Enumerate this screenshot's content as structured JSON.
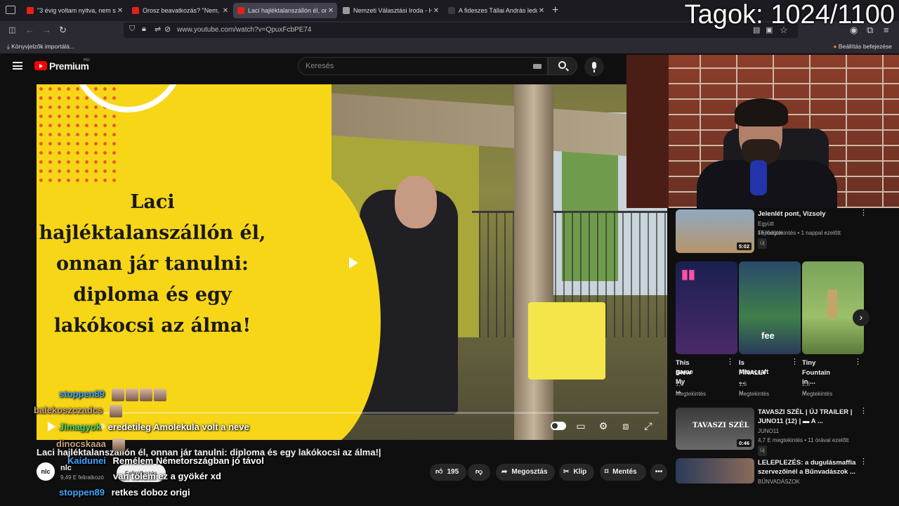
{
  "browser": {
    "tabs": [
      {
        "title": "\"3 évig voltam nyitva, nem szeretn",
        "active": false,
        "fav": "#e62117"
      },
      {
        "title": "Orosz beavatkozás? \"Nem, nem",
        "active": false,
        "fav": "#e62117"
      },
      {
        "title": "Laci hajléktalanszállón él, onnan",
        "active": true,
        "fav": "#e62117"
      },
      {
        "title": "Nemzeti Választási Iroda - Helyi",
        "active": false,
        "fav": "#9a9a9a"
      },
      {
        "title": "A fideszes Tállai András ledobta",
        "active": false,
        "fav": "#3b3b3b"
      }
    ],
    "url": "www.youtube.com/watch?v=QpuxFcbPE74",
    "bookmarks_import": "Könyvjelzők importálá...",
    "finish_setup": "Beállítás befejezése"
  },
  "overlay": {
    "members": "Tagok: 1024/1100"
  },
  "youtube": {
    "brand": "Premium",
    "region": "HU",
    "search_placeholder": "Keresés"
  },
  "video": {
    "thumbnail_text": [
      "Laci",
      "hajléktalanszállón él,",
      "onnan jár tanulni:",
      "diploma és egy",
      "lakókocsi az álma!"
    ],
    "title": "Laci hajléktalanszállón él, onnan jár tanulni: diploma és egy lakókocsi az álma!|",
    "channel": "nlc",
    "channel_avatar": "nlc",
    "subscribers": "9,49 E feliratkozó",
    "subscribe_label": "Feliratkozás",
    "likes": "195",
    "share_label": "Megosztás",
    "clip_label": "Klip",
    "save_label": "Mentés"
  },
  "sidebar": {
    "top_rec": {
      "title": "Jelenlét pont, Vizsoly",
      "channel": "Együtt Fejlődünk",
      "meta": "15 megtekintés • 1 nappal ezelőtt",
      "badge": "Új",
      "duration": "5:02"
    },
    "shorts": [
      {
        "title1": "This game",
        "title2": "Blew My ...",
        "views": "1,6 M",
        "views_label": "megtekintés",
        "color": "#2a3a6a"
      },
      {
        "title1": "Is Minecraft",
        "title2": "FINALLY ...",
        "views": "1,6 M",
        "views_label": "megtekintés",
        "color": "#3a6a8a",
        "overlay": "fee"
      },
      {
        "title1": "Tiny",
        "title2": "Fountain in ...",
        "views": "2,8 M",
        "views_label": "megtekintés",
        "color": "#5a8a4a"
      }
    ],
    "recs": [
      {
        "title1": "TAVASZI SZÉL | ÚJ TRAILER |",
        "title2": "JUNO11 (12) | ▬ A ...",
        "channel": "JUNO11",
        "meta": "4,7 E megtekintés • 11 órával ezelőtt",
        "badge": "Új",
        "duration": "0:46",
        "thumb_text": "TAVASZI SZÉL"
      },
      {
        "title1": "LELEPLEZÉS: a dugulásmaffia",
        "title2": "szervezőinél a Bűnvadászok ...",
        "channel": "BŰNVADÁSZOK",
        "meta": "",
        "badge": "",
        "duration": "",
        "thumb_text": ""
      }
    ]
  },
  "chat": [
    {
      "user": "stoppen89",
      "msg": "",
      "color": "#3ea6ff"
    },
    {
      "user": "balekoszczadcs",
      "msg": "",
      "color": "#c9a47a"
    },
    {
      "user": "Jimagyok",
      "msg": "eredetileg Amolekula volt a neve",
      "color": "#4cd964"
    },
    {
      "user": "dinocskaaa",
      "msg": "",
      "color": "#c9a47a"
    },
    {
      "user": "Kaidunei",
      "msg": "Remélem Németországban jó távol",
      "color": "#3ea6ff"
    },
    {
      "user": "",
      "msg": "van tőlem ez a gyökér xd",
      "color": "#ffffff"
    },
    {
      "user": "stoppen89",
      "msg": "retkes doboz origi",
      "color": "#3ea6ff"
    }
  ]
}
